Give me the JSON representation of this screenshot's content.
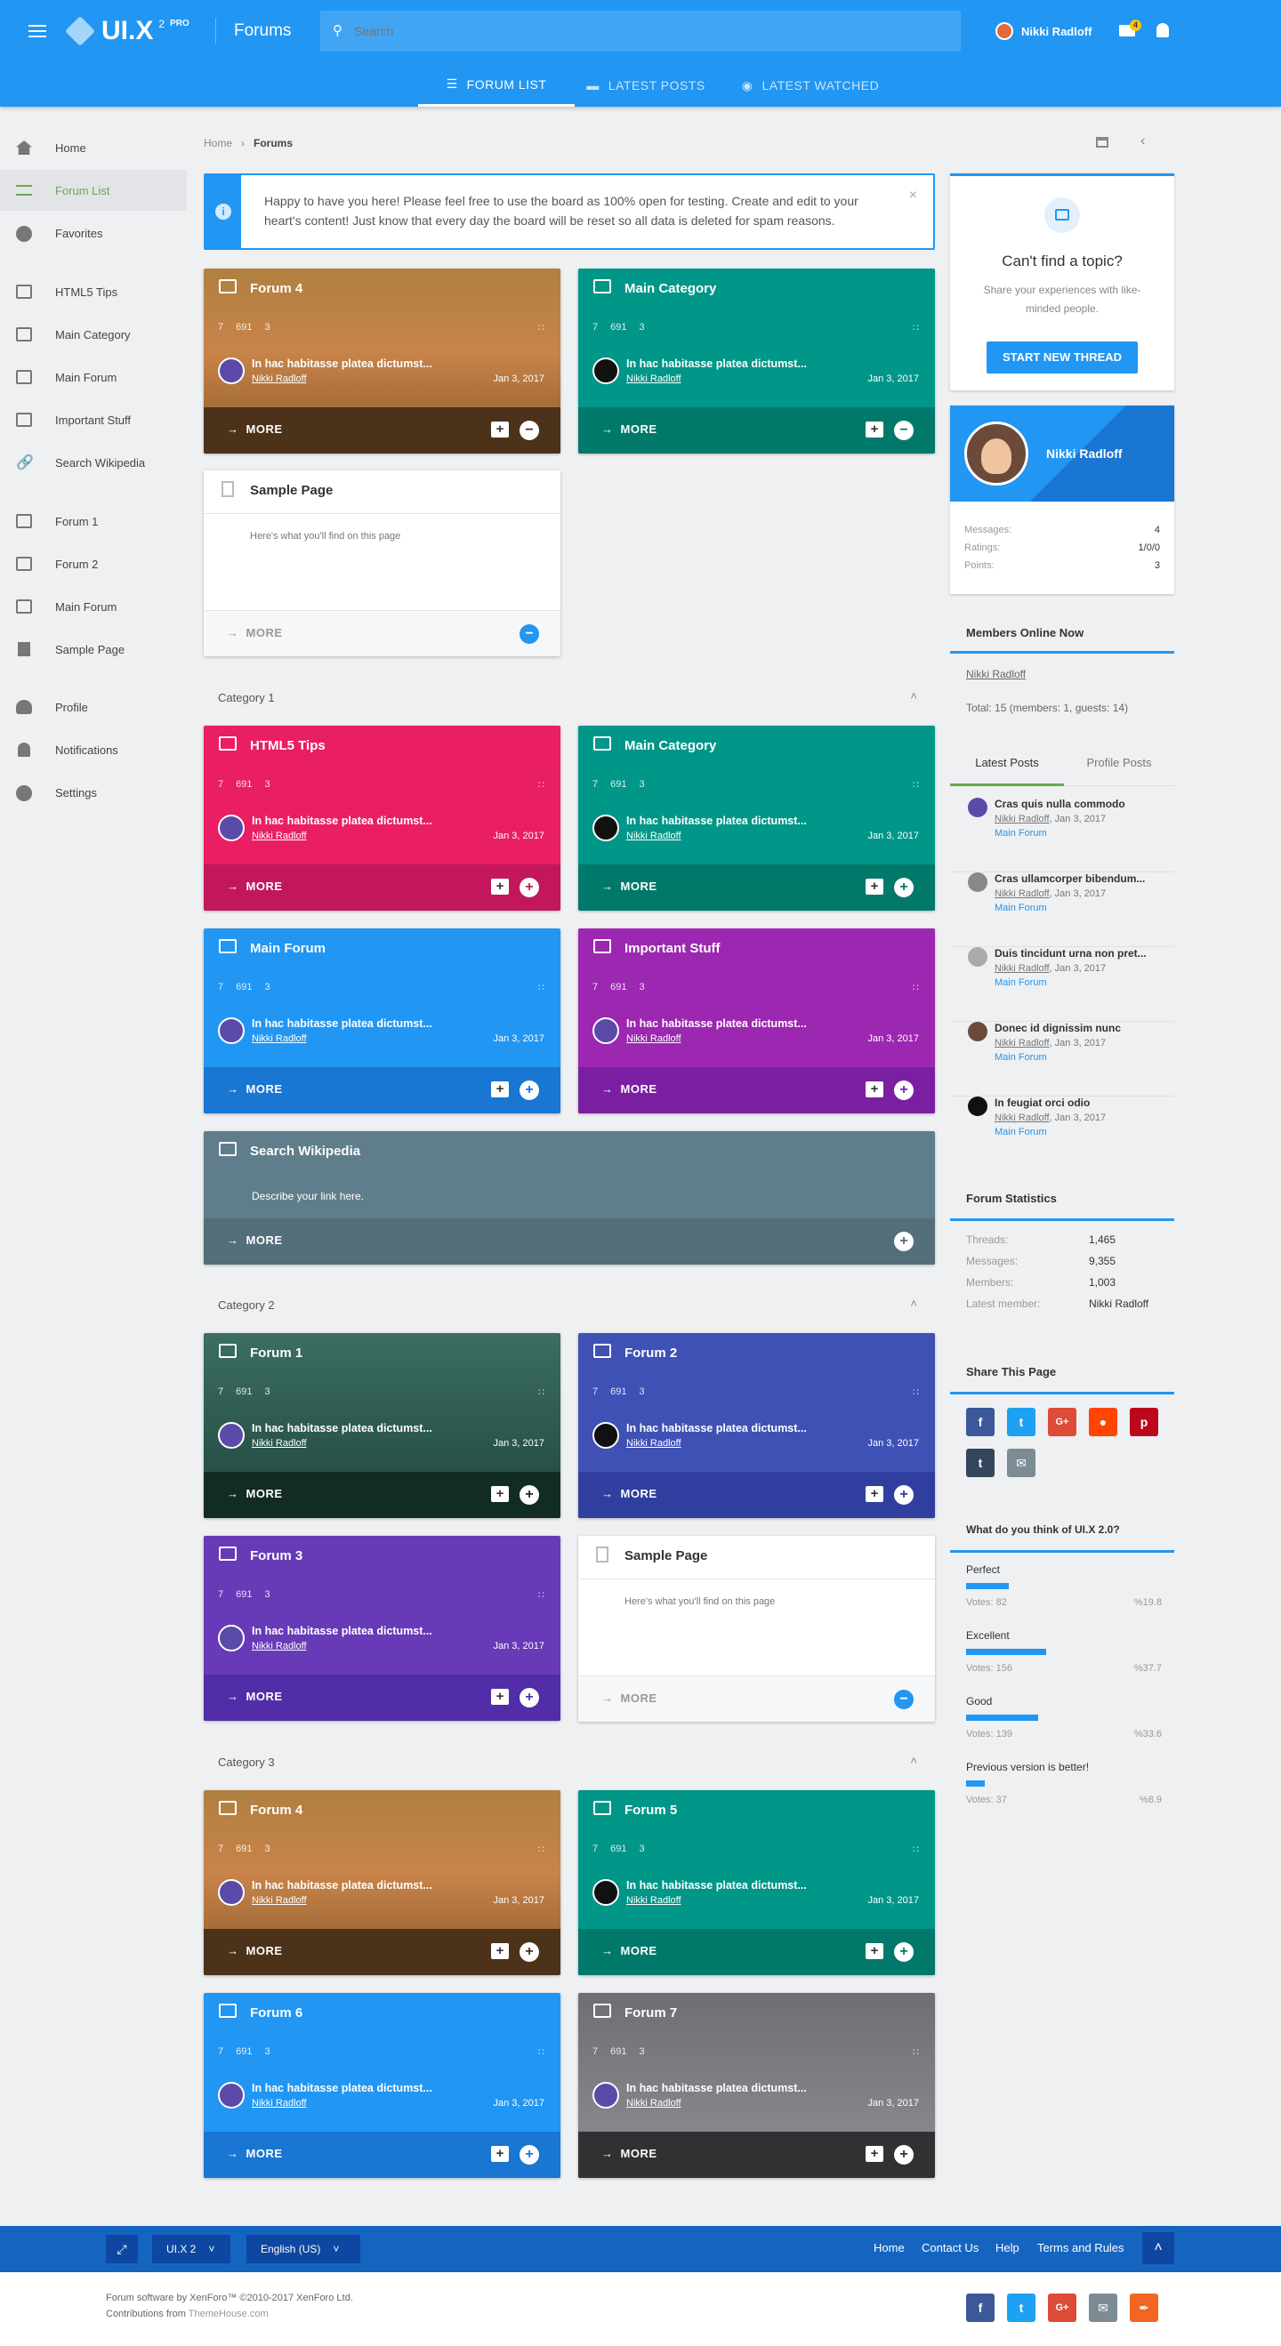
{
  "header": {
    "logo": "UI.X",
    "logo_sup": "2",
    "logo_badge": "PRO",
    "section_title": "Forums",
    "search_placeholder": "Search",
    "user_name": "Nikki Radloff",
    "msg_badge": "4"
  },
  "tabs": [
    {
      "label": "Forum list"
    },
    {
      "label": "Latest posts"
    },
    {
      "label": "Latest watched"
    }
  ],
  "sidebar": {
    "items": [
      {
        "label": "Home"
      },
      {
        "label": "Forum List"
      },
      {
        "label": "Favorites"
      },
      {
        "label": "HTML5 Tips"
      },
      {
        "label": "Main Category"
      },
      {
        "label": "Main Forum"
      },
      {
        "label": "Important Stuff"
      },
      {
        "label": "Search Wikipedia"
      },
      {
        "label": "Forum 1"
      },
      {
        "label": "Forum 2"
      },
      {
        "label": "Main Forum"
      },
      {
        "label": "Sample Page"
      },
      {
        "label": "Profile"
      },
      {
        "label": "Notifications"
      },
      {
        "label": "Settings"
      }
    ]
  },
  "breadcrumb": {
    "home": "Home",
    "current": "Forums"
  },
  "notice": "Happy to have you here! Please feel free to use the board as 100% open for testing. Create and edit to your heart's content! Just know that every day the board will be reset so all data is deleted for spam reasons.",
  "common": {
    "more": "MORE",
    "post_title": "In hac habitasse platea dictumst...",
    "post_user": "Nikki Radloff",
    "post_date": "Jan 3, 2017",
    "threads": "7",
    "messages": "691",
    "sub": "3",
    "sample_desc": "Here's what you'll find on this page",
    "wiki_desc": "Describe your link here."
  },
  "categories": {
    "c1": "Category 1",
    "c2": "Category 2",
    "c3": "Category 3"
  },
  "cards": {
    "forum4a": "Forum 4",
    "maincat1": "Main Category",
    "sample1": "Sample Page",
    "html5": "HTML5 Tips",
    "maincat2": "Main Category",
    "mainforum": "Main Forum",
    "important": "Important Stuff",
    "wiki": "Search Wikipedia",
    "forum1": "Forum 1",
    "forum2": "Forum 2",
    "forum3": "Forum 3",
    "sample2": "Sample Page",
    "forum4b": "Forum 4",
    "forum5": "Forum 5",
    "forum6": "Forum 6",
    "forum7": "Forum 7"
  },
  "cta": {
    "title": "Can't find a topic?",
    "text": "Share your experiences with like-minded people.",
    "button": "START NEW THREAD"
  },
  "profile": {
    "name": "Nikki Radloff",
    "messages_label": "Messages:",
    "messages": "4",
    "ratings_label": "Ratings:",
    "ratings": "1/0/0",
    "points_label": "Points:",
    "points": "3"
  },
  "online": {
    "title": "Members Online Now",
    "member": "Nikki Radloff",
    "total": "Total: 15 (members: 1, guests: 14)"
  },
  "posts_tabs": {
    "latest": "Latest Posts",
    "profile": "Profile Posts"
  },
  "latest_posts": [
    {
      "title": "Cras quis nulla commodo",
      "user": "Nikki Radloff",
      "date": ", Jan 3, 2017",
      "forum": "Main Forum"
    },
    {
      "title": "Cras ullamcorper bibendum...",
      "user": "Nikki Radloff",
      "date": ", Jan 3, 2017",
      "forum": "Main Forum"
    },
    {
      "title": "Duis tincidunt urna non pret...",
      "user": "Nikki Radloff",
      "date": ", Jan 3, 2017",
      "forum": "Main Forum"
    },
    {
      "title": "Donec id dignissim nunc",
      "user": "Nikki Radloff",
      "date": ", Jan 3, 2017",
      "forum": "Main Forum"
    },
    {
      "title": "In feugiat orci odio",
      "user": "Nikki Radloff",
      "date": ", Jan 3, 2017",
      "forum": "Main Forum"
    }
  ],
  "stats": {
    "title": "Forum Statistics",
    "rows": [
      {
        "k": "Threads:",
        "v": "1,465"
      },
      {
        "k": "Messages:",
        "v": "9,355"
      },
      {
        "k": "Members:",
        "v": "1,003"
      },
      {
        "k": "Latest member:",
        "v": "Nikki Radloff"
      }
    ]
  },
  "share": {
    "title": "Share This Page"
  },
  "poll": {
    "title": "What do you think of UI.X 2.0?",
    "options": [
      {
        "label": "Perfect",
        "votes": "Votes: 82",
        "pct": "%19.8",
        "fraction": 0.198
      },
      {
        "label": "Excellent",
        "votes": "Votes: 156",
        "pct": "%37.7",
        "fraction": 0.377
      },
      {
        "label": "Good",
        "votes": "Votes: 139",
        "pct": "%33.6",
        "fraction": 0.336
      },
      {
        "label": "Previous version is better!",
        "votes": "Votes: 37",
        "pct": "%8.9",
        "fraction": 0.089
      }
    ]
  },
  "footer": {
    "style": "UI.X 2",
    "lang": "English (US)",
    "links": [
      "Home",
      "Contact Us",
      "Help",
      "Terms and Rules"
    ],
    "copyright": "Forum software by XenForo™ ©2010-2017 XenForo Ltd.",
    "contrib_prefix": "Contributions from ",
    "contrib_link": "ThemeHouse.com"
  },
  "colors": {
    "primary": "#2196f3",
    "teal": "#009688",
    "pink": "#e91e63",
    "purple": "#9c27b0",
    "deeppurple": "#673ab7",
    "indigo": "#3f51b5",
    "bluegrey": "#607d8b"
  }
}
